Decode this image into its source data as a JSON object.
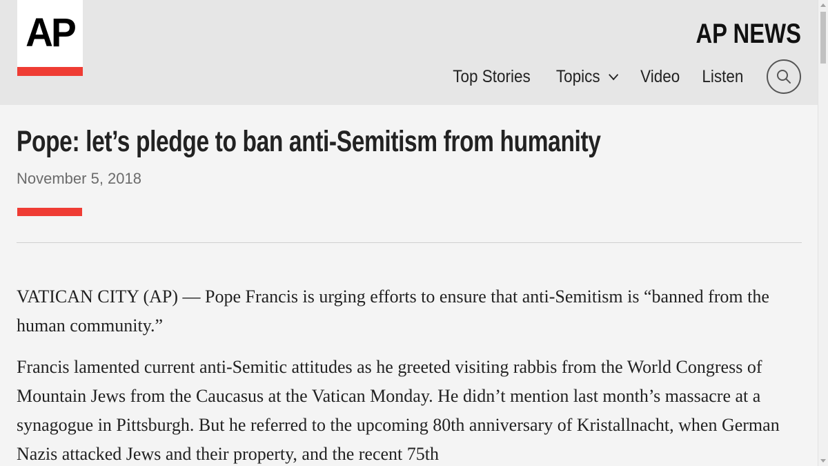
{
  "header": {
    "logo_text": "AP",
    "brand_name": "AP NEWS",
    "nav": {
      "top_stories": "Top Stories",
      "topics": "Topics",
      "video": "Video",
      "listen": "Listen"
    },
    "search_icon": "search-icon"
  },
  "colors": {
    "accent": "#ef3c34",
    "header_bg": "#e6e6e6",
    "page_bg": "#f4f4f4"
  },
  "article": {
    "headline": "Pope: let’s pledge to ban anti-Semitism from humanity",
    "date": "November 5, 2018",
    "paragraphs": [
      "VATICAN CITY (AP) — Pope Francis is urging efforts to ensure that anti-Semitism is “banned from the human community.”",
      "Francis lamented current anti-Semitic attitudes as he greeted visiting rabbis from the World Congress of Mountain Jews from the Caucasus at the Vatican Monday. He didn’t mention last month’s massacre at a synagogue in Pittsburgh. But he referred to the upcoming 80th anniversary of Kristallnacht, when German Nazis attacked Jews and their property, and the recent 75th"
    ]
  }
}
